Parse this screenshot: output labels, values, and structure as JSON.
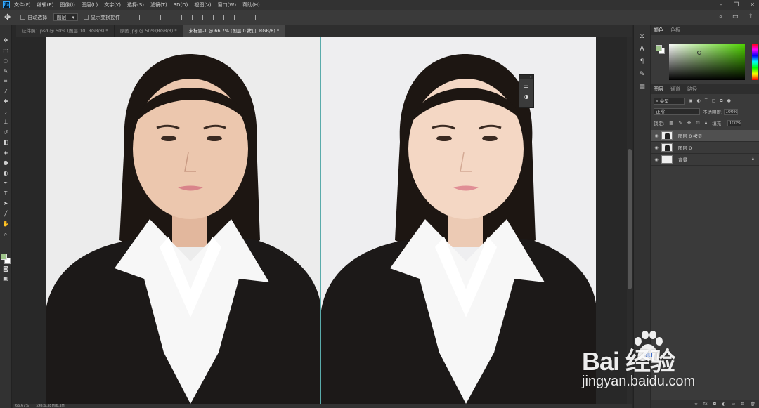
{
  "menu": {
    "logo": "Ps",
    "items": [
      "文件(F)",
      "编辑(E)",
      "图像(I)",
      "图层(L)",
      "文字(Y)",
      "选择(S)",
      "滤镜(T)",
      "3D(D)",
      "视图(V)",
      "窗口(W)",
      "帮助(H)"
    ]
  },
  "options": {
    "auto_select_label": "自动选择:",
    "auto_select_value": "图层",
    "show_transform_label": "显示变换控件"
  },
  "tabs": [
    {
      "label": "证件照1.psd @ 50% (图层 10, RGB/8) *",
      "active": false
    },
    {
      "label": "原图.jpg @ 50%(RGB/8) *",
      "active": false
    },
    {
      "label": "未标题-1 @ 66.7% (图层 0 拷贝, RGB/8) *",
      "active": true
    }
  ],
  "color_panel": {
    "tabs": [
      "颜色",
      "色板"
    ],
    "foreground_color": "#9ec48a",
    "background_color": "#ffffff"
  },
  "layers_panel": {
    "tabs": [
      "图层",
      "通道",
      "路径"
    ],
    "filter_kind": "类型",
    "blend_mode": "正常",
    "opacity_label": "不透明度:",
    "opacity_value": "100%",
    "lock_label": "锁定:",
    "fill_label": "填充:",
    "fill_value": "100%",
    "layers": [
      {
        "name": "图层 0 拷贝",
        "selected": true,
        "thumb": "portrait",
        "locked": false
      },
      {
        "name": "图层 0",
        "selected": false,
        "thumb": "portrait",
        "locked": false
      },
      {
        "name": "背景",
        "selected": false,
        "thumb": "white",
        "locked": true
      }
    ]
  },
  "status": {
    "zoom": "66.67%",
    "doc_info": "文档:6.38M/6.3M"
  },
  "watermark": {
    "brand": "Bai  经验",
    "url": "jingyan.baidu.com"
  },
  "colors": {
    "accent_guide": "#6fe3e3",
    "ui_dark": "#282828",
    "panel": "#3a3a3a"
  }
}
